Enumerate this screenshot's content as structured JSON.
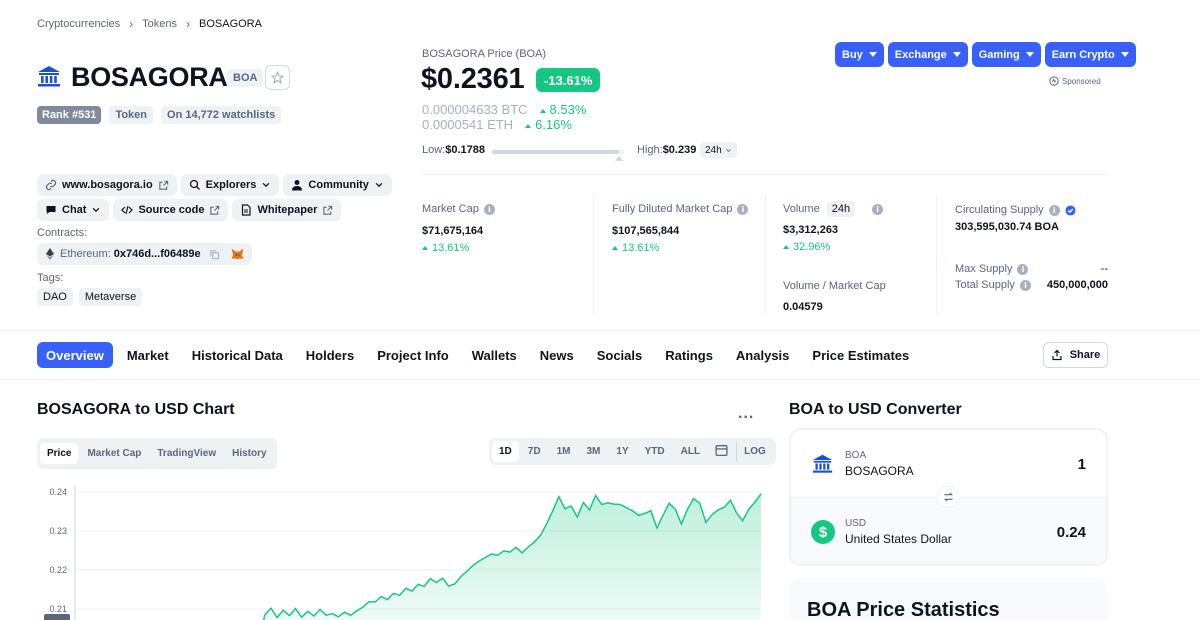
{
  "breadcrumb": {
    "items": [
      "Cryptocurrencies",
      "Tokens",
      "BOSAGORA"
    ]
  },
  "coin": {
    "name": "BOSAGORA",
    "symbol": "BOA",
    "rank": "Rank #531",
    "type": "Token",
    "watchlists": "On 14,772 watchlists"
  },
  "price": {
    "label": "BOSAGORA Price (BOA)",
    "value": "$0.2361",
    "change": "-13.61%",
    "btc_value": "0.000004633 BTC",
    "btc_change": "8.53%",
    "eth_value": "0.0000541 ETH",
    "eth_change": "6.16%",
    "low_label": "Low:",
    "low_value": "$0.1788",
    "high_label": "High:",
    "high_value": "$0.239",
    "range_fill": 0.96,
    "period": "24h"
  },
  "actions": {
    "buy": "Buy",
    "exchange": "Exchange",
    "gaming": "Gaming",
    "earn": "Earn Crypto",
    "sponsored": "Sponsored"
  },
  "links": {
    "website": "www.bosagora.io",
    "explorers": "Explorers",
    "community": "Community",
    "chat": "Chat",
    "source": "Source code",
    "whitepaper": "Whitepaper",
    "contracts_label": "Contracts:",
    "contract_chain": "Ethereum:",
    "contract_addr": "0x746d...f06489e",
    "tags_label": "Tags:",
    "tags": [
      "DAO",
      "Metaverse"
    ]
  },
  "stats": {
    "market_cap_label": "Market Cap",
    "market_cap": "$71,675,164",
    "market_cap_change": "13.61%",
    "fdmc_label": "Fully Diluted Market Cap",
    "fdmc": "$107,565,844",
    "fdmc_change": "13.61%",
    "volume_label": "Volume",
    "volume_period": "24h",
    "volume": "$3,312,263",
    "volume_change": "32.96%",
    "vol_mcap_label": "Volume / Market Cap",
    "vol_mcap": "0.04579",
    "circ_label": "Circulating Supply",
    "circ": "303,595,030.74 BOA",
    "max_label": "Max Supply",
    "max": "--",
    "total_label": "Total Supply",
    "total": "450,000,000"
  },
  "nav": {
    "tabs": [
      "Overview",
      "Market",
      "Historical Data",
      "Holders",
      "Project Info",
      "Wallets",
      "News",
      "Socials",
      "Ratings",
      "Analysis",
      "Price Estimates"
    ],
    "share": "Share"
  },
  "chart_section": {
    "title": "BOSAGORA to USD Chart",
    "type_tabs": [
      "Price",
      "Market Cap",
      "TradingView",
      "History"
    ],
    "ranges": [
      "1D",
      "7D",
      "1M",
      "3M",
      "1Y",
      "YTD",
      "ALL"
    ],
    "log": "LOG",
    "more": "..."
  },
  "chart_data": {
    "type": "area",
    "title": "",
    "xlabel": "",
    "ylabel": "",
    "yticks": [
      "0.24",
      "0.23",
      "0.22",
      "0.21"
    ],
    "ylim": [
      0.2075,
      0.242
    ],
    "color": "#16c784",
    "y": [
      0.19,
      0.19,
      0.19,
      0.19,
      0.19,
      0.19,
      0.19,
      0.19,
      0.19,
      0.19,
      0.19,
      0.19,
      0.19,
      0.19,
      0.19,
      0.19,
      0.19,
      0.19,
      0.19,
      0.19,
      0.19,
      0.19,
      0.19,
      0.19,
      0.19,
      0.19,
      0.19,
      0.19,
      0.19,
      0.19,
      0.19,
      0.2085,
      0.2102,
      0.2078,
      0.2097,
      0.2083,
      0.2101,
      0.2079,
      0.2094,
      0.2082,
      0.2099,
      0.2084,
      0.2088,
      0.208,
      0.2092,
      0.2084,
      0.2095,
      0.2105,
      0.2119,
      0.2118,
      0.2132,
      0.2124,
      0.214,
      0.2135,
      0.2153,
      0.2146,
      0.2163,
      0.2158,
      0.2178,
      0.2168,
      0.2179,
      0.2159,
      0.2164,
      0.2183,
      0.2197,
      0.2212,
      0.2223,
      0.2232,
      0.2241,
      0.2238,
      0.2249,
      0.2246,
      0.2258,
      0.2244,
      0.2259,
      0.2272,
      0.2289,
      0.2318,
      0.2352,
      0.2388,
      0.2357,
      0.2364,
      0.2336,
      0.2373,
      0.2354,
      0.2391,
      0.2368,
      0.2372,
      0.2369,
      0.2368,
      0.236,
      0.2352,
      0.234,
      0.2345,
      0.2352,
      0.2308,
      0.234,
      0.2371,
      0.2356,
      0.2318,
      0.2356,
      0.2383,
      0.2371,
      0.2322,
      0.2342,
      0.2354,
      0.2361,
      0.2379,
      0.2347,
      0.2326,
      0.2356,
      0.2374,
      0.2395
    ]
  },
  "converter": {
    "title": "BOA to USD Converter",
    "from_symbol": "BOA",
    "from_name": "BOSAGORA",
    "from_amount": "1",
    "to_symbol": "USD",
    "to_name": "United States Dollar",
    "to_amount": "0.24"
  },
  "statistics": {
    "title": "BOA Price Statistics"
  }
}
